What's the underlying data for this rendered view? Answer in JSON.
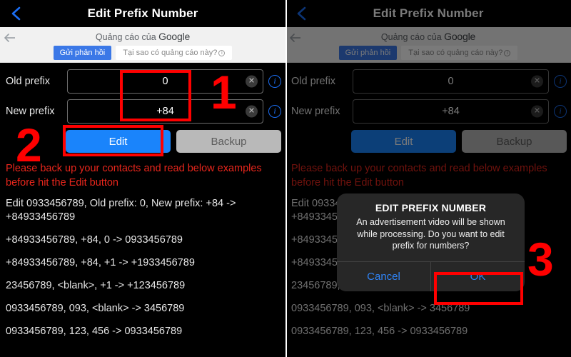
{
  "screen": {
    "navbar": {
      "title": "Edit Prefix Number",
      "back_icon": "chevron-left-icon"
    },
    "ad": {
      "label_prefix": "Quảng cáo của ",
      "brand": "Google",
      "feedback_button": "Gửi phản hồi",
      "why_button": "Tại sao có quảng cáo này?",
      "back_icon": "arrow-left-icon"
    },
    "form": {
      "old_prefix": {
        "label": "Old prefix",
        "value": "0",
        "placeholder": "Old prefix",
        "clear_icon": "clear-circle-icon",
        "info_icon": "info-circle-icon",
        "info_glyph": "i"
      },
      "new_prefix": {
        "label": "New prefix",
        "value": "+84",
        "placeholder": "New prefix",
        "clear_icon": "clear-circle-icon",
        "info_icon": "info-circle-icon",
        "info_glyph": "i"
      },
      "edit_button": "Edit",
      "backup_button": "Backup",
      "clear_glyph": "✕"
    },
    "warning": "Please back up your contacts and read below examples before hit the Edit button",
    "examples": [
      "Edit 0933456789, Old prefix: 0, New prefix: +84 -> +84933456789",
      "+84933456789, +84, 0 -> 0933456789",
      "+84933456789, +84, +1 -> +1933456789",
      "23456789, <blank>, +1 -> +123456789",
      "0933456789, 093, <blank> -> 3456789",
      "0933456789, 123, 456 -> 0933456789"
    ]
  },
  "dialog": {
    "title": "EDIT PREFIX NUMBER",
    "message": "An advertisement video will be shown while processing. Do you want to edit prefix for numbers?",
    "cancel_label": "Cancel",
    "ok_label": "OK"
  },
  "annotations": {
    "step1": "1",
    "step2": "2",
    "step3": "3",
    "color": "#ff0000"
  }
}
